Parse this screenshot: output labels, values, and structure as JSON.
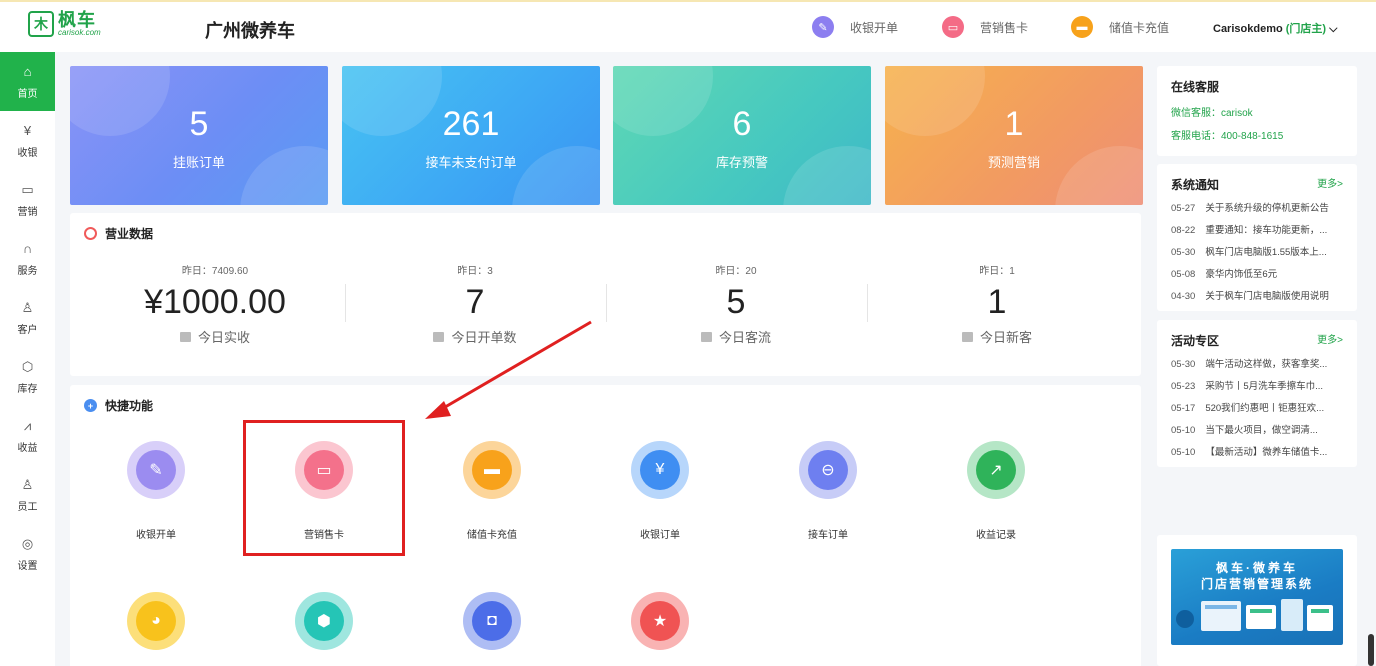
{
  "header": {
    "logo_cn": "枫车",
    "logo_en": "carisok.com",
    "store_name": "广州微养车",
    "actions": [
      {
        "label": "收银开单",
        "color": "#8c7ef0"
      },
      {
        "label": "营销售卡",
        "color": "#f46b86"
      },
      {
        "label": "储值卡充值",
        "color": "#f7a21b"
      }
    ],
    "user": "Carisokdemo",
    "role": "(门店主)"
  },
  "sidebar": {
    "items": [
      {
        "label": "首页",
        "icon": "home-icon"
      },
      {
        "label": "收银",
        "icon": "yen-icon"
      },
      {
        "label": "营销",
        "icon": "ticket-icon"
      },
      {
        "label": "服务",
        "icon": "headset-icon"
      },
      {
        "label": "客户",
        "icon": "user-icon"
      },
      {
        "label": "库存",
        "icon": "cube-icon"
      },
      {
        "label": "收益",
        "icon": "chart-icon"
      },
      {
        "label": "员工",
        "icon": "staff-icon"
      },
      {
        "label": "设置",
        "icon": "settings-icon"
      }
    ]
  },
  "stats": [
    {
      "value": "5",
      "label": "挂账订单"
    },
    {
      "value": "261",
      "label": "接车未支付订单"
    },
    {
      "value": "6",
      "label": "库存预警"
    },
    {
      "value": "1",
      "label": "预测营销"
    }
  ],
  "business": {
    "title": "营业数据",
    "items": [
      {
        "yesterday": "昨日：7409.60",
        "value": "¥1000.00",
        "label": "今日实收"
      },
      {
        "yesterday": "昨日：3",
        "value": "7",
        "label": "今日开单数"
      },
      {
        "yesterday": "昨日：20",
        "value": "5",
        "label": "今日客流"
      },
      {
        "yesterday": "昨日：1",
        "value": "1",
        "label": "今日新客"
      }
    ]
  },
  "quick": {
    "title": "快捷功能",
    "items": [
      {
        "label": "收银开单",
        "icon": "edit-icon",
        "ring": "#d8cff9",
        "core": "#9b8cf0"
      },
      {
        "label": "营销售卡",
        "icon": "card-icon",
        "ring": "#fbc6d0",
        "core": "#f4718b"
      },
      {
        "label": "储值卡充值",
        "icon": "wallet-icon",
        "ring": "#fcd59a",
        "core": "#f8a21b"
      },
      {
        "label": "收银订单",
        "icon": "cashier-icon",
        "ring": "#b7d6fb",
        "core": "#3f8ef2"
      },
      {
        "label": "接车订单",
        "icon": "car-icon",
        "ring": "#c7ccf7",
        "core": "#6e7ff0"
      },
      {
        "label": "收益记录",
        "icon": "growth-icon",
        "ring": "#b5e6c6",
        "core": "#2fb35a"
      },
      {
        "label": "",
        "icon": "pie-icon",
        "ring": "#fcdf7a",
        "core": "#f8c21c"
      },
      {
        "label": "",
        "icon": "hexagon-icon",
        "ring": "#9fe6df",
        "core": "#25c5b6"
      },
      {
        "label": "",
        "icon": "bag-icon",
        "ring": "#aebdf4",
        "core": "#4c6de8"
      },
      {
        "label": "",
        "icon": "bookmark-icon",
        "ring": "#f9b3b3",
        "core": "#f05353"
      }
    ]
  },
  "service": {
    "title": "在线客服",
    "wechat": "微信客服：carisok",
    "phone": "客服电话：400-848-1615"
  },
  "notices": {
    "title": "系统通知",
    "more": "更多>",
    "items": [
      {
        "date": "05-27",
        "text": "关于系统升级的停机更新公告"
      },
      {
        "date": "08-22",
        "text": "重要通知：接车功能更新，..."
      },
      {
        "date": "05-30",
        "text": "枫车门店电脑版1.55版本上..."
      },
      {
        "date": "05-08",
        "text": "豪华内饰低至6元"
      },
      {
        "date": "04-30",
        "text": "关于枫车门店电脑版使用说明"
      }
    ]
  },
  "activities": {
    "title": "活动专区",
    "more": "更多>",
    "items": [
      {
        "date": "05-30",
        "text": "端午活动这样做，获客拿奖..."
      },
      {
        "date": "05-23",
        "text": "采购节丨5月洗车季擦车巾..."
      },
      {
        "date": "05-17",
        "text": "520我们约惠吧丨钜惠狂欢..."
      },
      {
        "date": "05-10",
        "text": "当下最火项目，做空调清..."
      },
      {
        "date": "05-10",
        "text": "【最新活动】微养车储值卡..."
      }
    ]
  },
  "banner": {
    "line1": "枫车·微养车",
    "line2": "门店营销管理系统"
  }
}
